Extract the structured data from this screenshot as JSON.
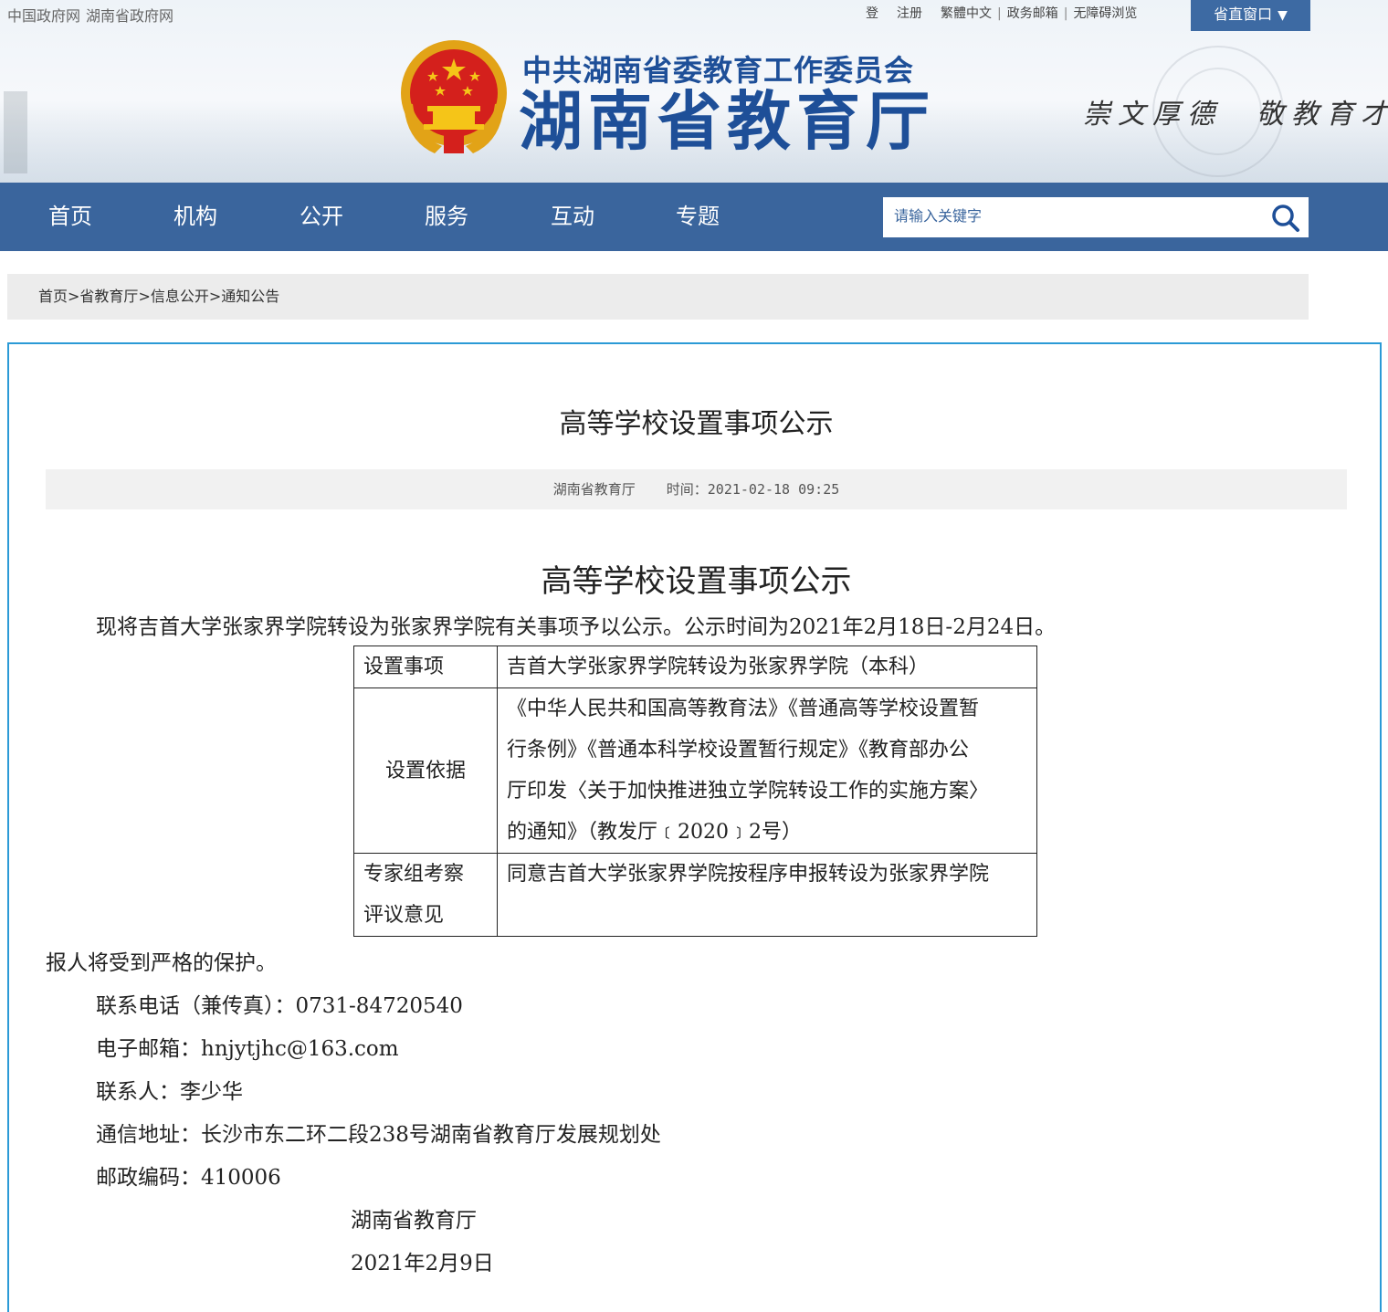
{
  "top_links": {
    "left": [
      "中国政府网",
      "湖南省政府网"
    ],
    "login": "登",
    "register": "注册",
    "traditional": "繁體中文",
    "mail": "政务邮箱",
    "accessible": "无障碍浏览",
    "window": "省直窗口",
    "window_arrow": "▼"
  },
  "header": {
    "subtitle": "中共湖南省委教育工作委员会",
    "title": "湖南省教育厅",
    "slogan": "崇文厚德　敬教育才",
    "emblem_icon": "national-emblem",
    "brand_color": "#1e4f98"
  },
  "nav": {
    "items": [
      "首页",
      "机构",
      "公开",
      "服务",
      "互动",
      "专题"
    ],
    "bg_color": "#3a659d"
  },
  "search": {
    "placeholder": "请输入关键字",
    "icon": "search-icon"
  },
  "breadcrumb": [
    "首页",
    "省教育厅",
    "信息公开",
    "通知公告"
  ],
  "article": {
    "title": "高等学校设置事项公示",
    "source": "湖南省教育厅",
    "time_label": "时间：",
    "time": "2021-02-18 09:25",
    "doc_title": "高等学校设置事项公示",
    "intro": "现将吉首大学张家界学院转设为张家界学院有关事项予以公示。公示时间为2021年2月18日-2月24日。",
    "table": [
      {
        "key": "设置事项",
        "value": "吉首大学张家界学院转设为张家界学院（本科）"
      },
      {
        "key": "设置依据",
        "value_lines": [
          "《中华人民共和国高等教育法》《普通高等学校设置暂",
          "行条例》《普通本科学校设置暂行规定》《教育部办公",
          "厅印发〈关于加快推进独立学院转设工作的实施方案〉",
          "的通知》（教发厅﹝2020﹞2号）"
        ]
      },
      {
        "key_lines": [
          "专家组考察",
          "评议意见"
        ],
        "value": "同意吉首大学张家界学院按程序申报转设为张家界学院"
      }
    ],
    "protect": "报人将受到严格的保护。",
    "contacts": [
      "联系电话（兼传真）：0731-84720540",
      "电子邮箱：hnjytjhc@163.com",
      "联系人：李少华",
      "通信地址：长沙市东二环二段238号湖南省教育厅发展规划处",
      "邮政编码：410006"
    ],
    "signature": "湖南省教育厅",
    "date": "2021年2月9日"
  },
  "accent_color": "#2b9ad6"
}
